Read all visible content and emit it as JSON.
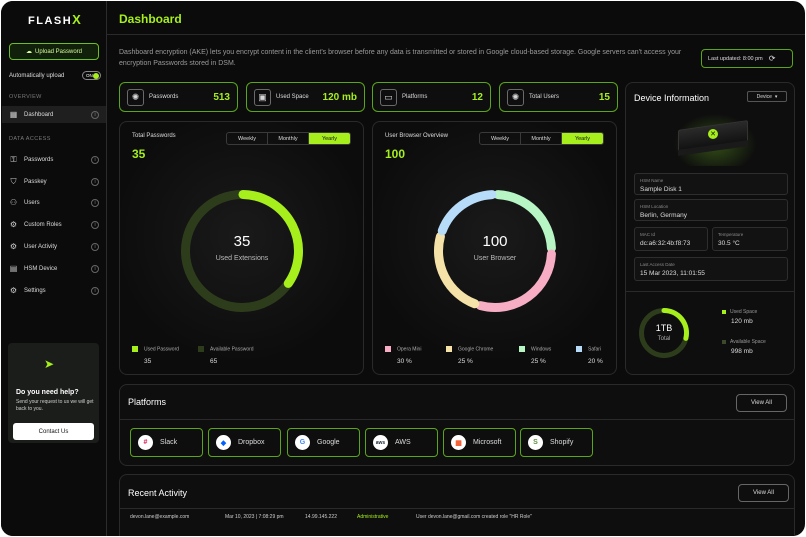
{
  "app": {
    "brand": "FLASH",
    "brand_x": "X"
  },
  "sidebar": {
    "upload_label": "Upload Password",
    "auto_upload_label": "Automatically upload",
    "auto_upload_toggle": "ON",
    "overview_label": "OVERVIEW",
    "data_access_label": "DATA ACCESS",
    "items": [
      {
        "label": "Dashboard",
        "icon": "grid-icon"
      },
      {
        "label": "Passwords",
        "icon": "key-icon"
      },
      {
        "label": "Passkey",
        "icon": "passkey-icon"
      },
      {
        "label": "Users",
        "icon": "users-icon"
      },
      {
        "label": "Custom Roles",
        "icon": "roles-icon"
      },
      {
        "label": "User Activity",
        "icon": "activity-icon"
      },
      {
        "label": "HSM Device",
        "icon": "device-icon"
      },
      {
        "label": "Settings",
        "icon": "gear-icon"
      }
    ],
    "help": {
      "title": "Do you need help?",
      "text": "Send your request to us we will get back to you.",
      "button": "Contact Us"
    }
  },
  "header": {
    "title": "Dashboard",
    "intro": "Dashboard encryption (AKE) lets you encrypt content in the client's browser before any data is transmitted or stored in Google cloud-based storage. Google servers can't access your encryption Passwords stored in DSM.",
    "last_updated": "Last updated: 8:00 pm"
  },
  "stats": [
    {
      "label": "Passwords",
      "value": "513",
      "icon": "sparkle-icon"
    },
    {
      "label": "Used Space",
      "value": "120 mb",
      "icon": "image-icon"
    },
    {
      "label": "Platforms",
      "value": "12",
      "icon": "platform-icon"
    },
    {
      "label": "Total Users",
      "value": "15",
      "icon": "users-icon"
    }
  ],
  "passwords_chart": {
    "title": "Total Passwords",
    "total": "35",
    "tabs": [
      "Weekly",
      "Monthly",
      "Yearly"
    ],
    "center_value": "35",
    "center_label": "Used Extensions",
    "legend": [
      {
        "label": "Used Password",
        "value": "35",
        "color": "#a6ef1d"
      },
      {
        "label": "Available Password",
        "value": "65",
        "color": "#2d3d1c"
      }
    ]
  },
  "browser_chart": {
    "title": "User Browser Overview",
    "total": "100",
    "tabs": [
      "Weekly",
      "Monthly",
      "Yearly"
    ],
    "center_value": "100",
    "center_label": "User Browser",
    "legend": [
      {
        "label": "Opera Mini",
        "value": "30 %",
        "color": "#f7aec4"
      },
      {
        "label": "Google Chrome",
        "value": "25 %",
        "color": "#f5e2a8"
      },
      {
        "label": "Windows",
        "value": "25 %",
        "color": "#b8f5c4"
      },
      {
        "label": "Safari",
        "value": "20 %",
        "color": "#b7dcfa"
      }
    ]
  },
  "chart_data": [
    {
      "type": "pie",
      "title": "Total Passwords",
      "categories": [
        "Used Password",
        "Available Password"
      ],
      "values": [
        35,
        65
      ]
    },
    {
      "type": "pie",
      "title": "User Browser Overview",
      "categories": [
        "Opera Mini",
        "Google Chrome",
        "Windows",
        "Safari"
      ],
      "values": [
        30,
        25,
        25,
        20
      ]
    }
  ],
  "device": {
    "title": "Device Information",
    "selector": "Device",
    "hsm_name_label": "HSM Name",
    "hsm_name": "Sample Disk 1",
    "hsm_location_label": "HSM Location",
    "hsm_location": "Berlin, Germany",
    "mac_label": "MAC Id",
    "mac": "dc:a6:32:4b:f8:73",
    "temp_label": "Temperature",
    "temp": "30.5 °C",
    "last_access_label": "Last Access Date",
    "last_access": "15 Mar 2023, 11:01:55",
    "capacity": "1TB",
    "capacity_label": "Total",
    "capacity_used_fraction": 0.12,
    "used_label": "Used Space",
    "used": "120 mb",
    "available_label": "Available Space",
    "available": "998 mb"
  },
  "platforms": {
    "title": "Platforms",
    "view_all": "View All",
    "items": [
      {
        "name": "Slack",
        "glyph": "#",
        "color": "#e01e5a"
      },
      {
        "name": "Dropbox",
        "glyph": "◆",
        "color": "#0061fe"
      },
      {
        "name": "Google",
        "glyph": "G",
        "color": "#4285f4"
      },
      {
        "name": "AWS",
        "glyph": "aws",
        "color": "#232f3e"
      },
      {
        "name": "Microsoft",
        "glyph": "▦",
        "color": "#f25022"
      },
      {
        "name": "Shopify",
        "glyph": "S",
        "color": "#5e8e3e"
      }
    ]
  },
  "activity": {
    "title": "Recent Activity",
    "view_all": "View All",
    "rows": [
      {
        "email": "devon.lane@example.com",
        "date": "Mar 10, 2023 | 7:08:29 pm",
        "ip": "14.99.145.222",
        "role": "Administrative",
        "action": "User devon.lane@gmail.com created role \"HR Role\""
      }
    ]
  }
}
